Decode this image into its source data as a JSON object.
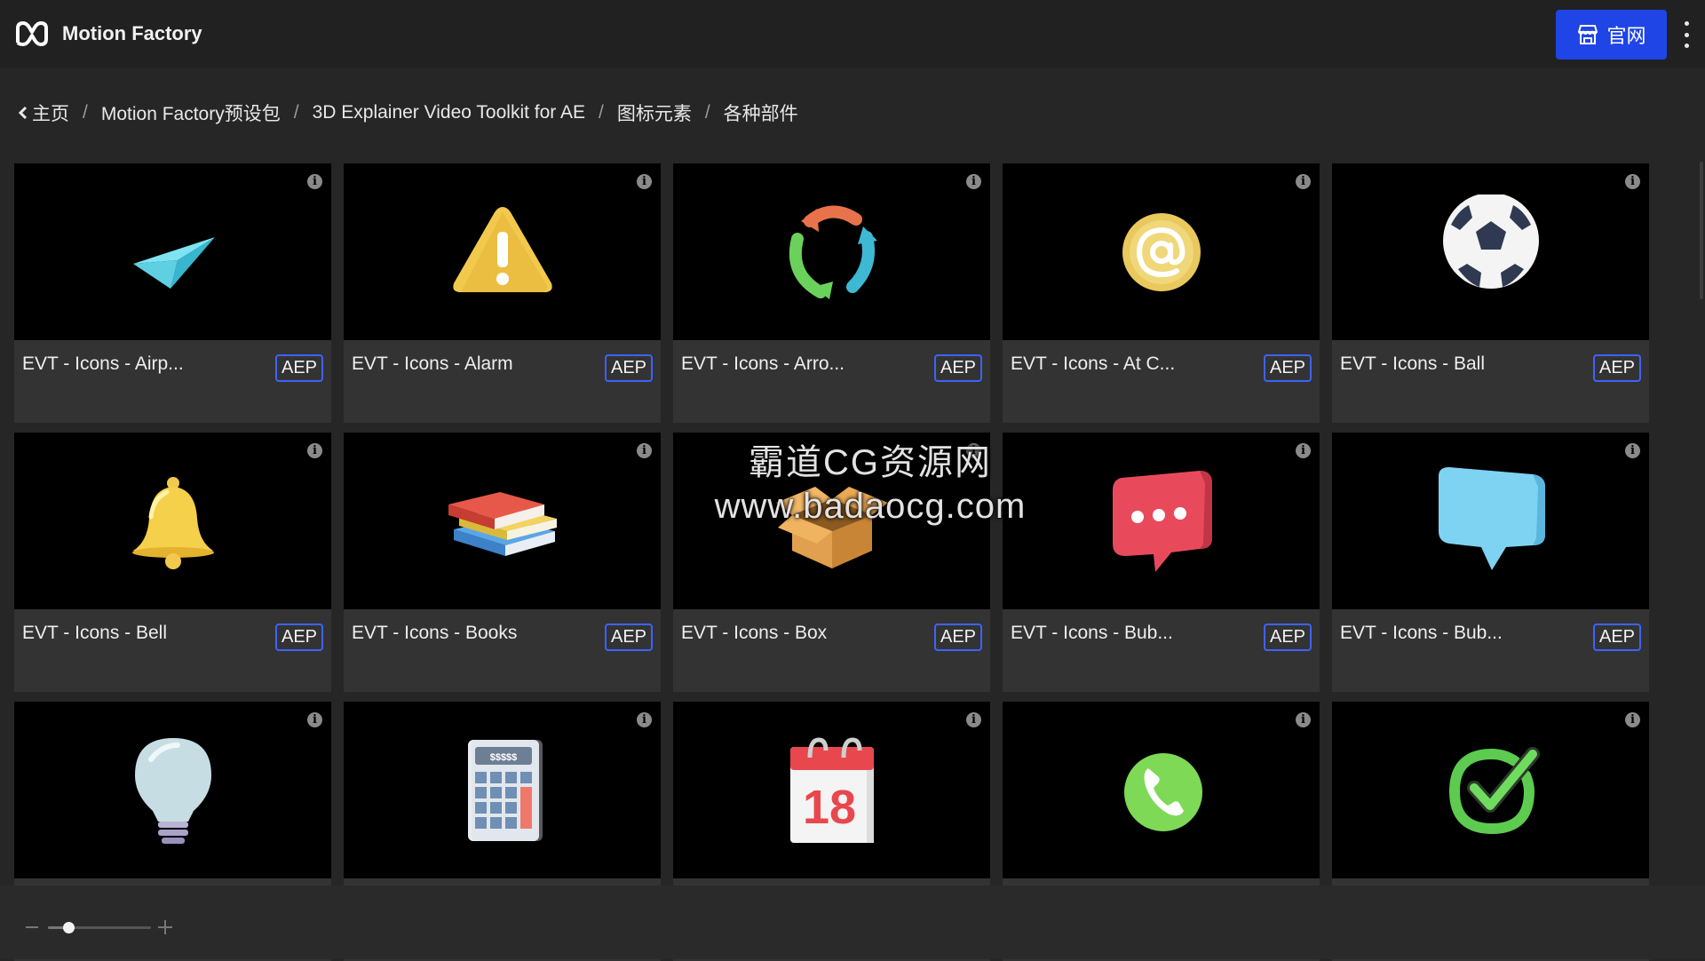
{
  "header": {
    "app_name": "Motion Factory",
    "site_button_label": "官网"
  },
  "breadcrumb": [
    {
      "label": "主页"
    },
    {
      "label": "Motion Factory预设包"
    },
    {
      "label": "3D Explainer Video Toolkit for AE"
    },
    {
      "label": "图标元素"
    },
    {
      "label": "各种部件"
    }
  ],
  "breadcrumb_separator": "/",
  "cards": [
    {
      "title": "EVT - Icons - Airp...",
      "badge": "AEP",
      "icon": "paper-plane-icon"
    },
    {
      "title": "EVT - Icons - Alarm",
      "badge": "AEP",
      "icon": "warning-triangle-icon"
    },
    {
      "title": "EVT - Icons - Arro...",
      "badge": "AEP",
      "icon": "circular-arrows-icon"
    },
    {
      "title": "EVT - Icons - At C...",
      "badge": "AEP",
      "icon": "at-coin-icon"
    },
    {
      "title": "EVT - Icons - Ball",
      "badge": "AEP",
      "icon": "soccer-ball-icon"
    },
    {
      "title": "EVT - Icons - Bell",
      "badge": "AEP",
      "icon": "bell-icon"
    },
    {
      "title": "EVT - Icons - Books",
      "badge": "AEP",
      "icon": "books-icon"
    },
    {
      "title": "EVT - Icons - Box",
      "badge": "AEP",
      "icon": "open-box-icon"
    },
    {
      "title": "EVT - Icons - Bub...",
      "badge": "AEP",
      "icon": "chat-bubble-dots-icon"
    },
    {
      "title": "EVT - Icons - Bub...",
      "badge": "AEP",
      "icon": "speech-bubble-icon"
    },
    {
      "title": "",
      "badge": "",
      "icon": "light-bulb-icon"
    },
    {
      "title": "",
      "badge": "",
      "icon": "calculator-icon"
    },
    {
      "title": "",
      "badge": "",
      "icon": "calendar-icon"
    },
    {
      "title": "",
      "badge": "",
      "icon": "phone-icon"
    },
    {
      "title": "",
      "badge": "",
      "icon": "checkmark-icon"
    }
  ],
  "art_labels": {
    "calculator_display": "$$$$$",
    "calendar_day": "18"
  },
  "watermark": {
    "line1": "霸道CG资源网",
    "line2": "www.badaocg.com"
  },
  "zoom": {
    "value": 0.2
  },
  "colors": {
    "accent": "#1f45e6",
    "badge_border": "#3d63ff",
    "card_bg": "#333333",
    "page_bg": "#262626"
  }
}
